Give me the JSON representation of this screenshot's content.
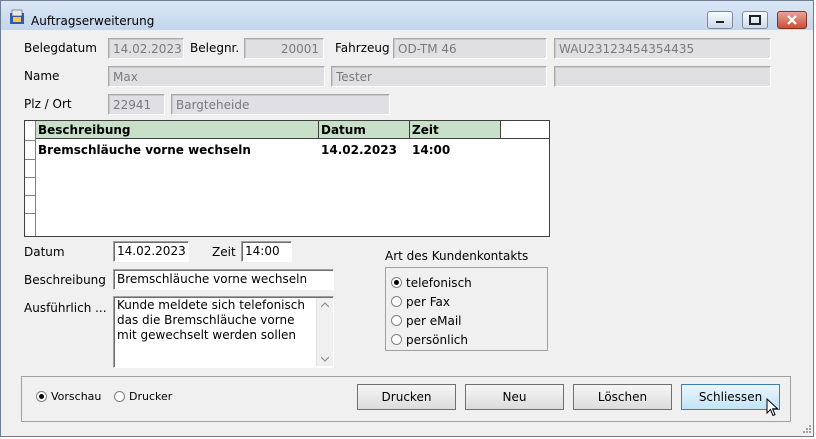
{
  "window": {
    "title": "Auftragserweiterung"
  },
  "header": {
    "belegdatum_label": "Belegdatum",
    "belegdatum": "14.02.2023",
    "belegnr_label": "Belegnr.",
    "belegnr": "20001",
    "fahrzeug_label": "Fahrzeug",
    "kennzeichen": "OD-TM 46",
    "fin": "WAU23123454354435",
    "name_label": "Name",
    "vorname": "Max",
    "nachname": "Tester",
    "extra": "",
    "plz_ort_label": "Plz / Ort",
    "plz": "22941",
    "ort": "Bargteheide"
  },
  "grid": {
    "columns": [
      "Beschreibung",
      "Datum",
      "Zeit"
    ],
    "rows": [
      {
        "beschreibung": "Bremschläuche vorne wechseln",
        "datum": "14.02.2023",
        "zeit": "14:00"
      }
    ]
  },
  "form": {
    "datum_label": "Datum",
    "datum": "14.02.2023",
    "zeit_label": "Zeit",
    "zeit": "14:00",
    "beschreibung_label": "Beschreibung",
    "beschreibung": "Bremschläuche vorne wechseln",
    "ausfuehrlich_label": "Ausführlich ...",
    "ausfuehrlich": "Kunde meldete sich telefonisch das die Bremschläuche vorne mit gewechselt werden sollen"
  },
  "kontakt": {
    "label": "Art des Kundenkontakts",
    "options": [
      "telefonisch",
      "per Fax",
      "per eMail",
      "persönlich"
    ],
    "selected": "telefonisch"
  },
  "output": {
    "options": [
      "Vorschau",
      "Drucker"
    ],
    "selected": "Vorschau"
  },
  "buttons": {
    "drucken": "Drucken",
    "neu": "Neu",
    "loeschen": "Löschen",
    "schliessen": "Schliessen"
  }
}
